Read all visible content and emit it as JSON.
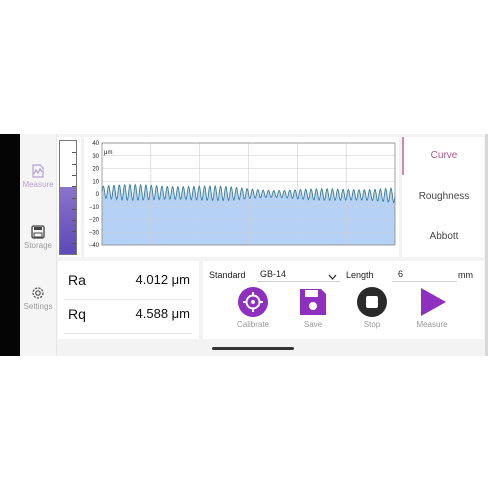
{
  "sidebar": {
    "items": [
      {
        "label": "Measure",
        "icon": "measure-icon",
        "active": true
      },
      {
        "label": "Storage",
        "icon": "storage-icon",
        "active": false
      },
      {
        "label": "Settings",
        "icon": "settings-icon",
        "active": false
      }
    ]
  },
  "gauge": {
    "level_fraction": 0.59
  },
  "chart": {
    "unit": "μm",
    "y_ticks": [
      "40",
      "30",
      "20",
      "10",
      "0",
      "−10",
      "−20",
      "−30",
      "−40"
    ],
    "ylim": [
      -40,
      40
    ]
  },
  "tabs": [
    "Curve",
    "Roughness",
    "Abbott"
  ],
  "active_tab": "Curve",
  "results": {
    "ra_label": "Ra",
    "ra_value": "4.012 μm",
    "rq_label": "Rq",
    "rq_value": "4.588 μm"
  },
  "controls": {
    "standard_label": "Standard",
    "standard_value": "GB-14",
    "length_label": "Length",
    "length_value": "6",
    "length_unit": "mm",
    "buttons": [
      {
        "label": "Calibrate",
        "icon": "crosshair-icon"
      },
      {
        "label": "Save",
        "icon": "save-icon"
      },
      {
        "label": "Stop",
        "icon": "stop-icon"
      },
      {
        "label": "Measure",
        "icon": "play-icon"
      }
    ]
  },
  "colors": {
    "accent_purple": "#8e2fbf",
    "stop_dark": "#2a2a2a",
    "trace": "#3b7f9a",
    "fill": "#a9c9f5",
    "active_tab": "#b0568a"
  }
}
